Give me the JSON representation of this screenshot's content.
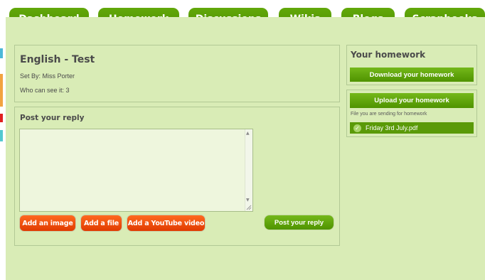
{
  "nav": {
    "tabs": [
      {
        "label": "Dashboard"
      },
      {
        "label": "Homework"
      },
      {
        "label": "Discussions"
      },
      {
        "label": "Wikis"
      },
      {
        "label": "Blogs"
      },
      {
        "label": "Scrapbooks"
      }
    ]
  },
  "assignment": {
    "title": "English - Test",
    "set_by": "Set By: Miss Porter",
    "visibility": "Who can see it: 3"
  },
  "reply": {
    "heading": "Post your reply",
    "textarea_value": "",
    "add_image_label": "Add an image",
    "add_file_label": "Add a file",
    "add_youtube_label": "Add a YouTube video",
    "post_label": "Post your reply"
  },
  "homework": {
    "heading": "Your homework",
    "download_label": "Download your homework",
    "upload_label": "Upload your homework",
    "sending_label": "File you are sending for homework",
    "file_name": "Friday 3rd July.pdf"
  },
  "colors": {
    "page_bg": "#d9ecb6",
    "tab_green": "#5a9e06",
    "button_green": "#5fa40c",
    "orange": "#f25a14"
  }
}
